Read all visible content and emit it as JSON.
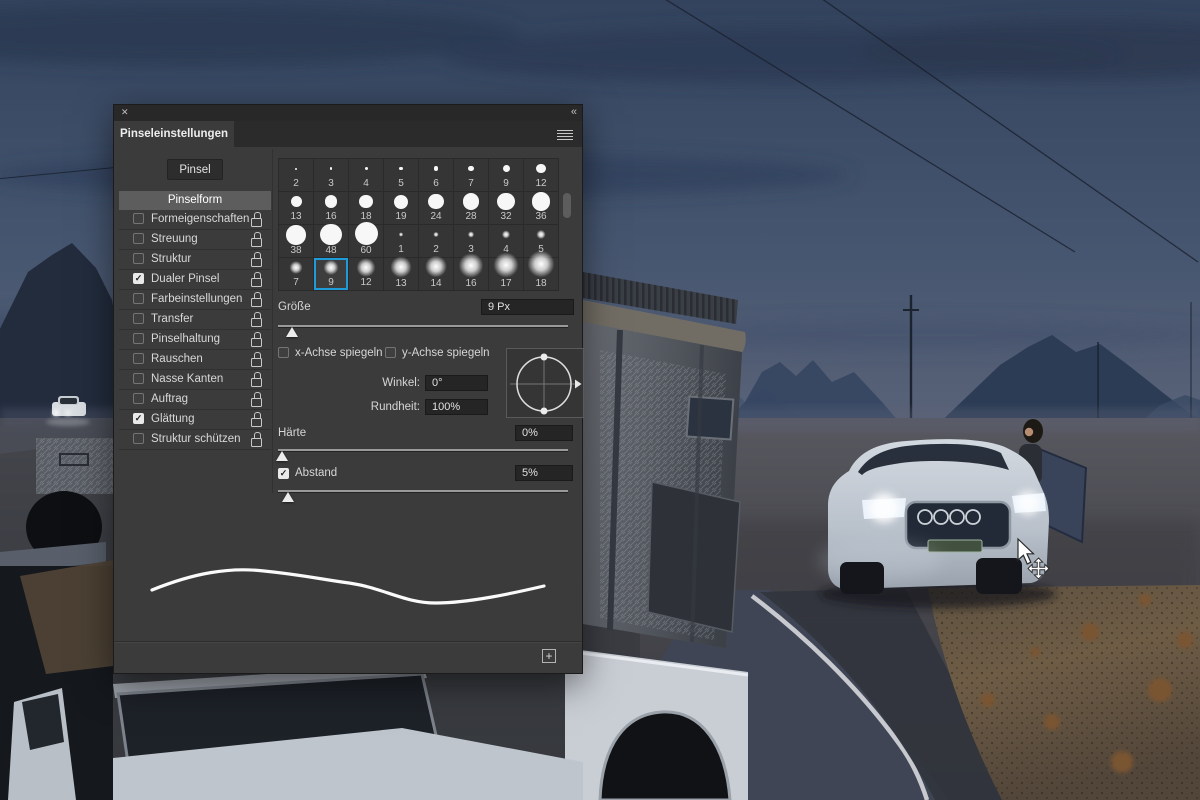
{
  "colors": {
    "panel_bg": "#3b3b3b",
    "selection_blue": "#1f9cd8",
    "sky_top": "#33435d",
    "sky_bottom": "#566177",
    "lit_dirt": "#6e5c45"
  },
  "panel": {
    "title": "Pinseleinstellungen",
    "close_icon": "✕",
    "collapse_icon": "««",
    "check_glyph": "✓",
    "pinsel_button": "Pinsel",
    "pinselform_item": "Pinselform",
    "settings_items": [
      {
        "label": "Formeigenschaften",
        "checked": false
      },
      {
        "label": "Streuung",
        "checked": false
      },
      {
        "label": "Struktur",
        "checked": false
      },
      {
        "label": "Dualer Pinsel",
        "checked": true
      },
      {
        "label": "Farbeinstellungen",
        "checked": false
      },
      {
        "label": "Transfer",
        "checked": false
      },
      {
        "label": "Pinselhaltung",
        "checked": false
      },
      {
        "label": "Rauschen",
        "checked": false
      },
      {
        "label": "Nasse Kanten",
        "checked": false
      },
      {
        "label": "Auftrag",
        "checked": false
      },
      {
        "label": "Glättung",
        "checked": true
      },
      {
        "label": "Struktur schützen",
        "checked": false
      }
    ],
    "brush_grid": {
      "selected_index": 25,
      "selected_label": "9",
      "brushes": [
        {
          "label": "2",
          "dot": 2,
          "soft": false
        },
        {
          "label": "3",
          "dot": 2.5,
          "soft": false
        },
        {
          "label": "4",
          "dot": 3,
          "soft": false
        },
        {
          "label": "5",
          "dot": 3.5,
          "soft": false
        },
        {
          "label": "6",
          "dot": 4.5,
          "soft": false
        },
        {
          "label": "7",
          "dot": 5.5,
          "soft": false
        },
        {
          "label": "9",
          "dot": 7,
          "soft": false
        },
        {
          "label": "12",
          "dot": 9.5,
          "soft": false
        },
        {
          "label": "13",
          "dot": 11,
          "soft": false
        },
        {
          "label": "16",
          "dot": 12.5,
          "soft": false
        },
        {
          "label": "18",
          "dot": 13.5,
          "soft": false
        },
        {
          "label": "19",
          "dot": 14,
          "soft": false
        },
        {
          "label": "24",
          "dot": 15.5,
          "soft": false
        },
        {
          "label": "28",
          "dot": 16.5,
          "soft": false
        },
        {
          "label": "32",
          "dot": 17.5,
          "soft": false
        },
        {
          "label": "36",
          "dot": 18.5,
          "soft": false
        },
        {
          "label": "38",
          "dot": 19.5,
          "soft": false
        },
        {
          "label": "48",
          "dot": 21.5,
          "soft": false
        },
        {
          "label": "60",
          "dot": 23,
          "soft": false
        },
        {
          "label": "1",
          "dot": 1.8,
          "soft": true
        },
        {
          "label": "2",
          "dot": 2.2,
          "soft": true
        },
        {
          "label": "3",
          "dot": 2.8,
          "soft": true
        },
        {
          "label": "4",
          "dot": 3.4,
          "soft": true
        },
        {
          "label": "5",
          "dot": 4,
          "soft": true
        },
        {
          "label": "7",
          "dot": 5.5,
          "soft": true
        },
        {
          "label": "9",
          "dot": 6.5,
          "soft": true
        },
        {
          "label": "12",
          "dot": 8,
          "soft": true
        },
        {
          "label": "13",
          "dot": 9,
          "soft": true
        },
        {
          "label": "14",
          "dot": 9.5,
          "soft": true
        },
        {
          "label": "16",
          "dot": 10.5,
          "soft": true
        },
        {
          "label": "17",
          "dot": 11,
          "soft": true
        },
        {
          "label": "18",
          "dot": 11.5,
          "soft": true
        }
      ]
    },
    "size_row": {
      "label": "Größe",
      "value": "9 Px"
    },
    "flip_x_label": "x-Achse spiegeln",
    "flip_y_label": "y-Achse spiegeln",
    "angle_row": {
      "label": "Winkel:",
      "value": "0°"
    },
    "roundness_row": {
      "label": "Rundheit:",
      "value": "100%"
    },
    "hardness_row": {
      "label": "Härte",
      "value": "0%"
    },
    "spacing_row": {
      "label": "Abstand",
      "value": "5%",
      "checked": true
    },
    "new_brush_button": "+"
  }
}
